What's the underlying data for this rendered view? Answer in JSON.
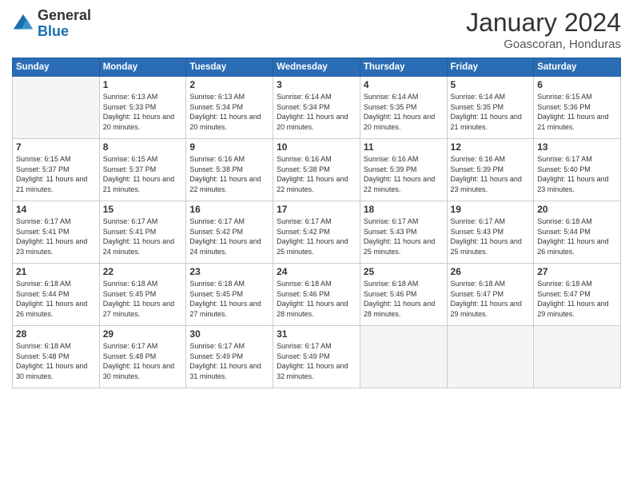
{
  "header": {
    "logo_general": "General",
    "logo_blue": "Blue",
    "month_title": "January 2024",
    "location": "Goascoran, Honduras"
  },
  "weekdays": [
    "Sunday",
    "Monday",
    "Tuesday",
    "Wednesday",
    "Thursday",
    "Friday",
    "Saturday"
  ],
  "weeks": [
    [
      {
        "day": "",
        "sunrise": "",
        "sunset": "",
        "daylight": "",
        "empty": true
      },
      {
        "day": "1",
        "sunrise": "Sunrise: 6:13 AM",
        "sunset": "Sunset: 5:33 PM",
        "daylight": "Daylight: 11 hours and 20 minutes.",
        "empty": false
      },
      {
        "day": "2",
        "sunrise": "Sunrise: 6:13 AM",
        "sunset": "Sunset: 5:34 PM",
        "daylight": "Daylight: 11 hours and 20 minutes.",
        "empty": false
      },
      {
        "day": "3",
        "sunrise": "Sunrise: 6:14 AM",
        "sunset": "Sunset: 5:34 PM",
        "daylight": "Daylight: 11 hours and 20 minutes.",
        "empty": false
      },
      {
        "day": "4",
        "sunrise": "Sunrise: 6:14 AM",
        "sunset": "Sunset: 5:35 PM",
        "daylight": "Daylight: 11 hours and 20 minutes.",
        "empty": false
      },
      {
        "day": "5",
        "sunrise": "Sunrise: 6:14 AM",
        "sunset": "Sunset: 5:35 PM",
        "daylight": "Daylight: 11 hours and 21 minutes.",
        "empty": false
      },
      {
        "day": "6",
        "sunrise": "Sunrise: 6:15 AM",
        "sunset": "Sunset: 5:36 PM",
        "daylight": "Daylight: 11 hours and 21 minutes.",
        "empty": false
      }
    ],
    [
      {
        "day": "7",
        "sunrise": "Sunrise: 6:15 AM",
        "sunset": "Sunset: 5:37 PM",
        "daylight": "Daylight: 11 hours and 21 minutes.",
        "empty": false
      },
      {
        "day": "8",
        "sunrise": "Sunrise: 6:15 AM",
        "sunset": "Sunset: 5:37 PM",
        "daylight": "Daylight: 11 hours and 21 minutes.",
        "empty": false
      },
      {
        "day": "9",
        "sunrise": "Sunrise: 6:16 AM",
        "sunset": "Sunset: 5:38 PM",
        "daylight": "Daylight: 11 hours and 22 minutes.",
        "empty": false
      },
      {
        "day": "10",
        "sunrise": "Sunrise: 6:16 AM",
        "sunset": "Sunset: 5:38 PM",
        "daylight": "Daylight: 11 hours and 22 minutes.",
        "empty": false
      },
      {
        "day": "11",
        "sunrise": "Sunrise: 6:16 AM",
        "sunset": "Sunset: 5:39 PM",
        "daylight": "Daylight: 11 hours and 22 minutes.",
        "empty": false
      },
      {
        "day": "12",
        "sunrise": "Sunrise: 6:16 AM",
        "sunset": "Sunset: 5:39 PM",
        "daylight": "Daylight: 11 hours and 23 minutes.",
        "empty": false
      },
      {
        "day": "13",
        "sunrise": "Sunrise: 6:17 AM",
        "sunset": "Sunset: 5:40 PM",
        "daylight": "Daylight: 11 hours and 23 minutes.",
        "empty": false
      }
    ],
    [
      {
        "day": "14",
        "sunrise": "Sunrise: 6:17 AM",
        "sunset": "Sunset: 5:41 PM",
        "daylight": "Daylight: 11 hours and 23 minutes.",
        "empty": false
      },
      {
        "day": "15",
        "sunrise": "Sunrise: 6:17 AM",
        "sunset": "Sunset: 5:41 PM",
        "daylight": "Daylight: 11 hours and 24 minutes.",
        "empty": false
      },
      {
        "day": "16",
        "sunrise": "Sunrise: 6:17 AM",
        "sunset": "Sunset: 5:42 PM",
        "daylight": "Daylight: 11 hours and 24 minutes.",
        "empty": false
      },
      {
        "day": "17",
        "sunrise": "Sunrise: 6:17 AM",
        "sunset": "Sunset: 5:42 PM",
        "daylight": "Daylight: 11 hours and 25 minutes.",
        "empty": false
      },
      {
        "day": "18",
        "sunrise": "Sunrise: 6:17 AM",
        "sunset": "Sunset: 5:43 PM",
        "daylight": "Daylight: 11 hours and 25 minutes.",
        "empty": false
      },
      {
        "day": "19",
        "sunrise": "Sunrise: 6:17 AM",
        "sunset": "Sunset: 5:43 PM",
        "daylight": "Daylight: 11 hours and 25 minutes.",
        "empty": false
      },
      {
        "day": "20",
        "sunrise": "Sunrise: 6:18 AM",
        "sunset": "Sunset: 5:44 PM",
        "daylight": "Daylight: 11 hours and 26 minutes.",
        "empty": false
      }
    ],
    [
      {
        "day": "21",
        "sunrise": "Sunrise: 6:18 AM",
        "sunset": "Sunset: 5:44 PM",
        "daylight": "Daylight: 11 hours and 26 minutes.",
        "empty": false
      },
      {
        "day": "22",
        "sunrise": "Sunrise: 6:18 AM",
        "sunset": "Sunset: 5:45 PM",
        "daylight": "Daylight: 11 hours and 27 minutes.",
        "empty": false
      },
      {
        "day": "23",
        "sunrise": "Sunrise: 6:18 AM",
        "sunset": "Sunset: 5:45 PM",
        "daylight": "Daylight: 11 hours and 27 minutes.",
        "empty": false
      },
      {
        "day": "24",
        "sunrise": "Sunrise: 6:18 AM",
        "sunset": "Sunset: 5:46 PM",
        "daylight": "Daylight: 11 hours and 28 minutes.",
        "empty": false
      },
      {
        "day": "25",
        "sunrise": "Sunrise: 6:18 AM",
        "sunset": "Sunset: 5:46 PM",
        "daylight": "Daylight: 11 hours and 28 minutes.",
        "empty": false
      },
      {
        "day": "26",
        "sunrise": "Sunrise: 6:18 AM",
        "sunset": "Sunset: 5:47 PM",
        "daylight": "Daylight: 11 hours and 29 minutes.",
        "empty": false
      },
      {
        "day": "27",
        "sunrise": "Sunrise: 6:18 AM",
        "sunset": "Sunset: 5:47 PM",
        "daylight": "Daylight: 11 hours and 29 minutes.",
        "empty": false
      }
    ],
    [
      {
        "day": "28",
        "sunrise": "Sunrise: 6:18 AM",
        "sunset": "Sunset: 5:48 PM",
        "daylight": "Daylight: 11 hours and 30 minutes.",
        "empty": false
      },
      {
        "day": "29",
        "sunrise": "Sunrise: 6:17 AM",
        "sunset": "Sunset: 5:48 PM",
        "daylight": "Daylight: 11 hours and 30 minutes.",
        "empty": false
      },
      {
        "day": "30",
        "sunrise": "Sunrise: 6:17 AM",
        "sunset": "Sunset: 5:49 PM",
        "daylight": "Daylight: 11 hours and 31 minutes.",
        "empty": false
      },
      {
        "day": "31",
        "sunrise": "Sunrise: 6:17 AM",
        "sunset": "Sunset: 5:49 PM",
        "daylight": "Daylight: 11 hours and 32 minutes.",
        "empty": false
      },
      {
        "day": "",
        "sunrise": "",
        "sunset": "",
        "daylight": "",
        "empty": true
      },
      {
        "day": "",
        "sunrise": "",
        "sunset": "",
        "daylight": "",
        "empty": true
      },
      {
        "day": "",
        "sunrise": "",
        "sunset": "",
        "daylight": "",
        "empty": true
      }
    ]
  ]
}
